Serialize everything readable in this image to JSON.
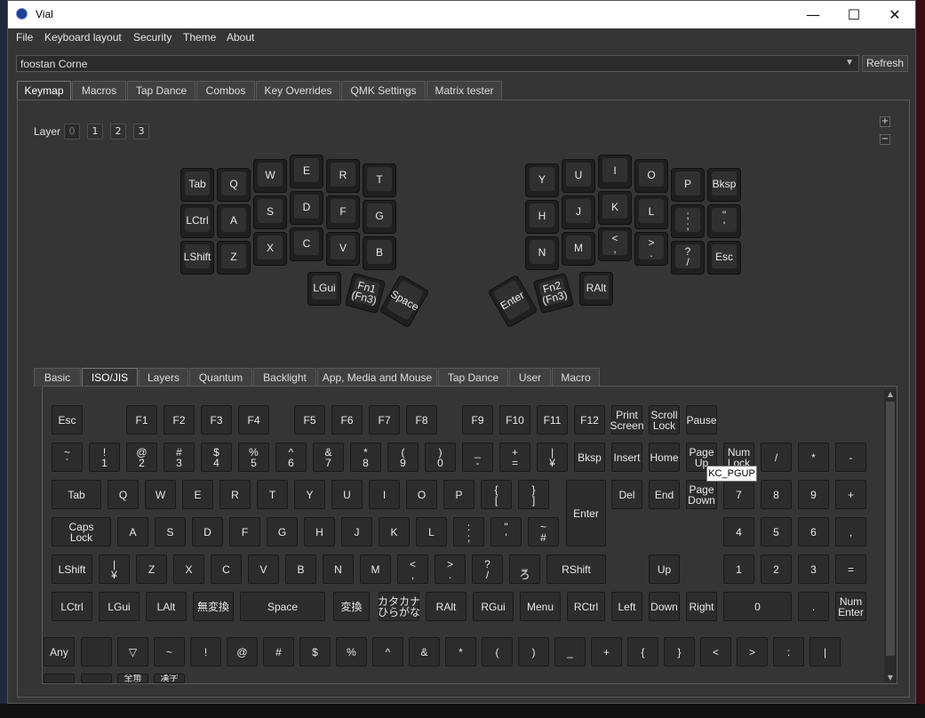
{
  "window": {
    "title": "Vial",
    "controls": {
      "minimize": "—",
      "maximize": "☐",
      "close": "✕"
    }
  },
  "menu": [
    "File",
    "Keyboard layout",
    "Security",
    "Theme",
    "About"
  ],
  "keyboard_select": {
    "value": "foostan Corne",
    "refresh_label": "Refresh"
  },
  "main_tabs": [
    "Keymap",
    "Macros",
    "Tap Dance",
    "Combos",
    "Key Overrides",
    "QMK Settings",
    "Matrix tester"
  ],
  "layers": {
    "label": "Layer",
    "items": [
      "0",
      "1",
      "2",
      "3"
    ],
    "active": "0",
    "plus": "+",
    "minus": "−"
  },
  "layout_keys": [
    "Tab",
    "Q",
    "W",
    "E",
    "R",
    "T",
    "Y",
    "U",
    "I",
    "O",
    "P",
    "Bksp",
    "LCtrl",
    "A",
    "S",
    "D",
    "F",
    "G",
    "H",
    "J",
    "K",
    "L",
    ";\n;",
    "\"\n'",
    "LShift",
    "Z",
    "X",
    "C",
    "V",
    "B",
    "N",
    "M",
    "<\n,",
    ">\n.",
    "?\n/",
    "Esc",
    "LGui",
    "Fn1\n(Fn3)",
    "Space",
    "Enter",
    "Fn2\n(Fn3)",
    "RAlt"
  ],
  "picker_tabs": [
    "Basic",
    "ISO/JIS",
    "Layers",
    "Quantum",
    "Backlight",
    "App, Media and Mouse",
    "Tap Dance",
    "User",
    "Macro"
  ],
  "picker_keys": {
    "row1": [
      "Esc",
      "F1",
      "F2",
      "F3",
      "F4",
      "F5",
      "F6",
      "F7",
      "F8",
      "F9",
      "F10",
      "F11",
      "F12",
      "Print\nScreen",
      "Scroll\nLock",
      "Pause"
    ],
    "row2": [
      "~\n`",
      "!\n1",
      "@\n2",
      "#\n3",
      "$\n4",
      "%\n5",
      "^\n6",
      "&\n7",
      "*\n8",
      "(\n9",
      ")\n0",
      "_\n-",
      "+\n=",
      "|\n¥",
      "Bksp",
      "Insert",
      "Home",
      "Page\nUp",
      "Num\nLock",
      "/",
      "*",
      "-"
    ],
    "row3": [
      "Tab",
      "Q",
      "W",
      "E",
      "R",
      "T",
      "Y",
      "U",
      "I",
      "O",
      "P",
      "{\n[",
      "}\n]",
      "Enter",
      "Del",
      "End",
      "Page\nDown",
      "7",
      "8",
      "9",
      "+"
    ],
    "row4": [
      "Caps\nLock",
      "A",
      "S",
      "D",
      "F",
      "G",
      "H",
      "J",
      "K",
      "L",
      ":\n;",
      "\"\n'",
      "~\n#",
      "4",
      "5",
      "6",
      ","
    ],
    "row5": [
      "LShift",
      "|\n¥",
      "Z",
      "X",
      "C",
      "V",
      "B",
      "N",
      "M",
      "<\n,",
      ">\n.",
      "?\n/",
      "_\nろ",
      "RShift",
      "Up",
      "1",
      "2",
      "3",
      "="
    ],
    "row6": [
      "LCtrl",
      "LGui",
      "LAlt",
      "無変換",
      "Space",
      "変換",
      "カタカナ\nひらがな",
      "RAlt",
      "RGui",
      "Menu",
      "RCtrl",
      "Left",
      "Down",
      "Right",
      "0",
      ".",
      "Num\nEnter"
    ],
    "row7": [
      "Any",
      "",
      "▽",
      "~",
      "!",
      "@",
      "#",
      "$",
      "%",
      "^",
      "&",
      "*",
      "(",
      ")",
      "_",
      "+",
      "{",
      "}",
      "<",
      ">",
      ":",
      "|"
    ],
    "row8": [
      "",
      "",
      "全角\n半角",
      "漢字"
    ]
  },
  "tooltip": "KC_PGUP"
}
